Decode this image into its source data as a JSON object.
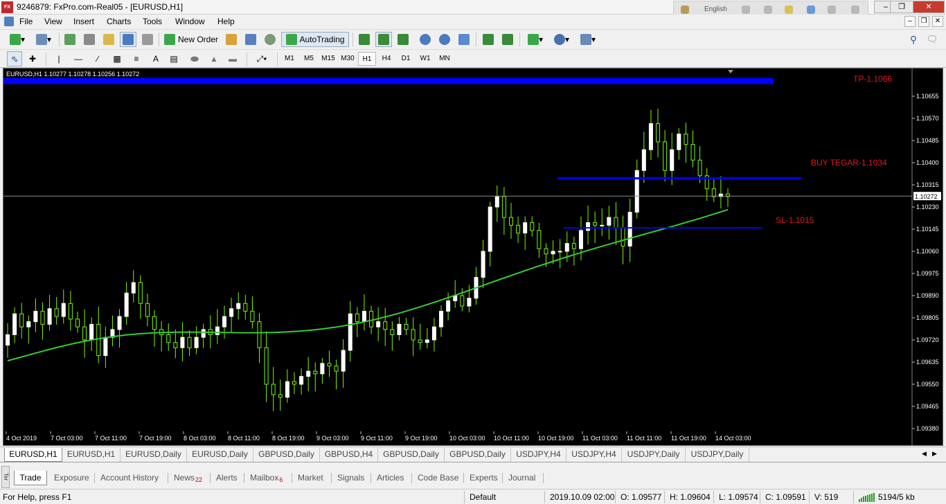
{
  "window": {
    "app_icon_text": "FX PRO",
    "title": "9246879: FxPro.com-Real05 - [EURUSD,H1]",
    "language": "English"
  },
  "menu": [
    "File",
    "View",
    "Insert",
    "Charts",
    "Tools",
    "Window",
    "Help"
  ],
  "toolbar": {
    "new_order": "New Order",
    "autotrading": "AutoTrading"
  },
  "timeframes": [
    "M1",
    "M5",
    "M15",
    "M30",
    "H1",
    "H4",
    "D1",
    "W1",
    "MN"
  ],
  "active_timeframe": "H1",
  "chart": {
    "symbol_info": "EURUSD,H1  1.10277 1.10278 1.10256 1.10272",
    "annotations": {
      "tp": "TP-1.1066",
      "buy": "BUY TEGAR-1.1034",
      "sl": "SL-1.1015"
    },
    "current_price_label": "1.10272",
    "colors": {
      "background": "#000000",
      "candles": "#ffffff",
      "wicks": "#7cfc00",
      "moving_average": "#32cd32",
      "levels": "#0000ff",
      "annotation_text": "#e01818"
    }
  },
  "chart_data": {
    "type": "candlestick",
    "symbol": "EURUSD",
    "timeframe": "H1",
    "ohlc_header": {
      "open": 1.10277,
      "high": 1.10278,
      "low": 1.10256,
      "close": 1.10272
    },
    "y_ticks": [
      "1.10655",
      "1.10570",
      "1.10485",
      "1.10400",
      "1.10315",
      "1.10230",
      "1.10145",
      "1.10060",
      "1.09975",
      "1.09890",
      "1.09805",
      "1.09720",
      "1.09635",
      "1.09550",
      "1.09465",
      "1.09380"
    ],
    "x_ticks": [
      "4 Oct 2019",
      "7 Oct 03:00",
      "7 Oct 11:00",
      "7 Oct 19:00",
      "8 Oct 03:00",
      "8 Oct 11:00",
      "8 Oct 19:00",
      "9 Oct 03:00",
      "9 Oct 11:00",
      "9 Oct 19:00",
      "10 Oct 03:00",
      "10 Oct 11:00",
      "10 Oct 19:00",
      "11 Oct 03:00",
      "11 Oct 11:00",
      "11 Oct 19:00",
      "14 Oct 03:00"
    ],
    "ylim": [
      1.0938,
      1.1074
    ],
    "close_series": [
      1.0974,
      1.0982,
      1.0977,
      1.0979,
      1.0983,
      1.0978,
      1.0984,
      1.0981,
      1.0986,
      1.098,
      1.0977,
      1.0972,
      1.0978,
      1.0966,
      1.0973,
      1.0976,
      1.0981,
      1.099,
      1.0994,
      1.0986,
      1.0981,
      1.0976,
      1.0974,
      1.0971,
      1.0969,
      1.0973,
      1.0969,
      1.0973,
      1.0976,
      1.0974,
      1.0977,
      1.0981,
      1.0984,
      1.0986,
      1.0983,
      1.0979,
      1.0969,
      1.0955,
      1.0951,
      1.095,
      1.0956,
      1.0955,
      1.0958,
      1.096,
      1.0959,
      1.0963,
      1.0962,
      1.096,
      1.0968,
      1.0982,
      1.0979,
      1.0983,
      1.0977,
      1.0979,
      1.0976,
      1.0974,
      1.0978,
      1.0976,
      1.0972,
      1.0971,
      1.0972,
      1.0977,
      1.0983,
      1.0987,
      1.0989,
      1.0985,
      1.0988,
      1.0996,
      1.1006,
      1.1023,
      1.1027,
      1.1019,
      1.1016,
      1.1013,
      1.1017,
      1.1014,
      1.1007,
      1.1005,
      1.1006,
      1.1006,
      1.1009,
      1.1007,
      1.1014,
      1.1017,
      1.1016,
      1.1016,
      1.1019,
      1.1015,
      1.1008,
      1.1021,
      1.1037,
      1.1045,
      1.1055,
      1.1048,
      1.1037,
      1.1045,
      1.1051,
      1.1047,
      1.1041,
      1.1035,
      1.103,
      1.1027,
      1.1028,
      1.1027
    ],
    "moving_average": {
      "start": 1.0964,
      "end": 1.1022
    },
    "levels": [
      {
        "label": "TP-1.1066",
        "price": 1.1066
      },
      {
        "label": "BUY TEGAR-1.1034",
        "price": 1.1034
      },
      {
        "label": "SL-1.1015",
        "price": 1.1015
      }
    ],
    "current_price": 1.10272
  },
  "chart_tabs": [
    "EURUSD,H1",
    "EURUSD,H1",
    "EURUSD,Daily",
    "EURUSD,Daily",
    "GBPUSD,Daily",
    "GBPUSD,H4",
    "GBPUSD,Daily",
    "GBPUSD,Daily",
    "USDJPY,H4",
    "USDJPY,H4",
    "USDJPY,Daily",
    "USDJPY,Daily"
  ],
  "terminal": {
    "vertical_label": "Ter",
    "tabs": [
      {
        "label": "Trade",
        "badge": ""
      },
      {
        "label": "Exposure",
        "badge": ""
      },
      {
        "label": "Account History",
        "badge": ""
      },
      {
        "label": "News",
        "badge": "22"
      },
      {
        "label": "Alerts",
        "badge": ""
      },
      {
        "label": "Mailbox",
        "badge": "6"
      },
      {
        "label": "Market",
        "badge": ""
      },
      {
        "label": "Signals",
        "badge": ""
      },
      {
        "label": "Articles",
        "badge": ""
      },
      {
        "label": "Code Base",
        "badge": ""
      },
      {
        "label": "Experts",
        "badge": ""
      },
      {
        "label": "Journal",
        "badge": ""
      }
    ]
  },
  "status": {
    "help": "For Help, press F1",
    "profile": "Default",
    "datetime": "2019.10.09 02:00",
    "open": "O: 1.09577",
    "high": "H: 1.09604",
    "low": "L: 1.09574",
    "close": "C: 1.09591",
    "volume": "V: 519",
    "traffic": "5194/5 kb"
  }
}
